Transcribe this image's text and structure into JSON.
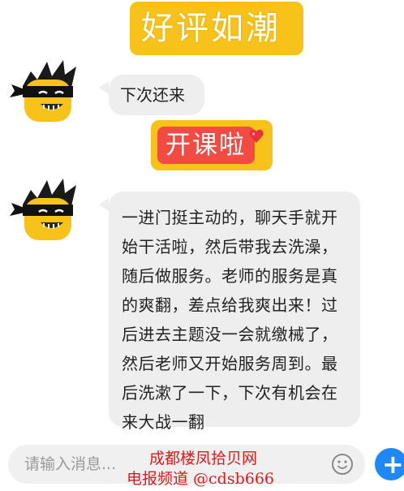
{
  "banners": {
    "top": "好评如潮",
    "middle": "开课啦"
  },
  "messages": [
    {
      "lines": [
        "下次还来"
      ]
    },
    {
      "lines": [
        "一进门挺主动的，聊天手就开",
        "始干活啦，然后带我去洗澡，",
        "随后做服务。老师的服务是真",
        "的爽翻，差点给我爽出来！过",
        "后进去主题没一会就缴械了，",
        "然后老师又开始服务周到。最",
        "后洗漱了一下，下次有机会在",
        "来大战一翻"
      ]
    }
  ],
  "input": {
    "placeholder": "请输入消息..."
  },
  "watermark": {
    "line1": "成都楼凤拾贝网",
    "line2": "电报频道 @cdsb666"
  },
  "icons": {
    "avatar": "masked-bandit-avatar-icon",
    "emoji": "smiley-face-icon",
    "plus": "plus-icon",
    "heart": "heart-icon"
  },
  "colors": {
    "banner_yellow": "#f7c21a",
    "banner_red": "#f24b43",
    "bubble_gray": "#eeeeef",
    "accent_blue": "#1e88f5",
    "watermark_red": "#e01818"
  }
}
